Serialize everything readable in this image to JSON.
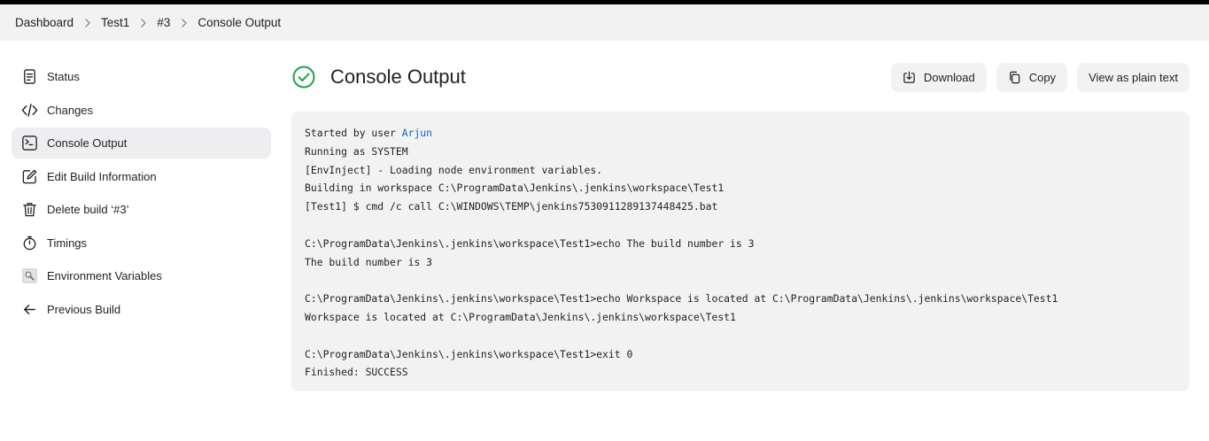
{
  "breadcrumb": {
    "items": [
      "Dashboard",
      "Test1",
      "#3",
      "Console Output"
    ]
  },
  "sidebar": {
    "items": [
      {
        "label": "Status",
        "icon": "status-icon"
      },
      {
        "label": "Changes",
        "icon": "code-icon"
      },
      {
        "label": "Console Output",
        "icon": "terminal-icon",
        "active": true
      },
      {
        "label": "Edit Build Information",
        "icon": "edit-icon"
      },
      {
        "label": "Delete build ‘#3’",
        "icon": "trash-icon"
      },
      {
        "label": "Timings",
        "icon": "stopwatch-icon"
      },
      {
        "label": "Environment Variables",
        "icon": "magnifier-icon"
      },
      {
        "label": "Previous Build",
        "icon": "arrow-left-icon"
      }
    ]
  },
  "header": {
    "title": "Console Output",
    "status_icon": "success-check-icon",
    "status_color": "#1ea446"
  },
  "actions": {
    "download_label": "Download",
    "copy_label": "Copy",
    "plain_text_label": "View as plain text"
  },
  "console": {
    "started_prefix": "Started by user ",
    "user_link": "Arjun",
    "link_color": "#1565c0",
    "lines": [
      "Running as SYSTEM",
      "[EnvInject] - Loading node environment variables.",
      "Building in workspace C:\\ProgramData\\Jenkins\\.jenkins\\workspace\\Test1",
      "[Test1] $ cmd /c call C:\\WINDOWS\\TEMP\\jenkins7530911289137448425.bat",
      "",
      "C:\\ProgramData\\Jenkins\\.jenkins\\workspace\\Test1>echo The build number is 3",
      "The build number is 3",
      "",
      "C:\\ProgramData\\Jenkins\\.jenkins\\workspace\\Test1>echo Workspace is located at C:\\ProgramData\\Jenkins\\.jenkins\\workspace\\Test1",
      "Workspace is located at C:\\ProgramData\\Jenkins\\.jenkins\\workspace\\Test1",
      "",
      "C:\\ProgramData\\Jenkins\\.jenkins\\workspace\\Test1>exit 0",
      "Finished: SUCCESS"
    ]
  }
}
